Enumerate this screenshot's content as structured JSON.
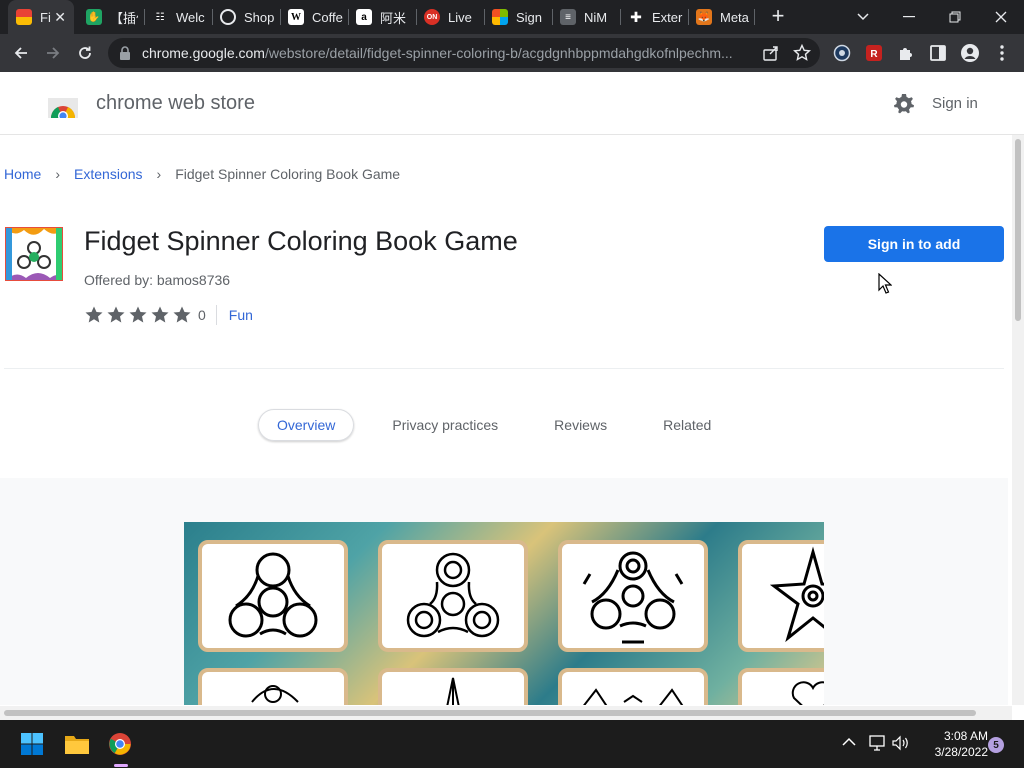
{
  "browser": {
    "tabs": [
      {
        "title": "Fi",
        "favicon": "chrome-store-icon",
        "color": "#e94235",
        "active": true
      },
      {
        "title": "【插件",
        "favicon": "green-hand-icon",
        "color": "#1fa463",
        "active": false
      },
      {
        "title": "Welc",
        "favicon": "list-icon",
        "color": "#ffffff",
        "active": false
      },
      {
        "title": "Shop",
        "favicon": "aperture-icon",
        "color": "#ffffff",
        "active": false
      },
      {
        "title": "Coffe",
        "favicon": "wikipedia-icon",
        "color": "#ffffff",
        "active": false
      },
      {
        "title": "阿米",
        "favicon": "amazon-icon",
        "color": "#ffffff",
        "active": false
      },
      {
        "title": "Live",
        "favicon": "live-icon",
        "color": "#d93025",
        "active": false
      },
      {
        "title": "Sign",
        "favicon": "microsoft-icon",
        "color": "#f25022",
        "active": false
      },
      {
        "title": "NiM",
        "favicon": "nim-icon",
        "color": "#5f6368",
        "active": false
      },
      {
        "title": "Exter",
        "favicon": "puzzle-icon",
        "color": "#ffffff",
        "active": false
      },
      {
        "title": "Meta",
        "favicon": "metamask-icon",
        "color": "#e2761b",
        "active": false
      }
    ],
    "url_host": "chrome.google.com",
    "url_path": "/webstore/detail/fidget-spinner-coloring-b/acgdgnhbppmdahgdkofnlpechm..."
  },
  "header": {
    "store_name": "chrome web store",
    "signin": "Sign in"
  },
  "breadcrumb": {
    "home": "Home",
    "extensions": "Extensions",
    "current": "Fidget Spinner Coloring Book Game"
  },
  "app": {
    "title": "Fidget Spinner Coloring Book Game",
    "offered_by": "Offered by: bamos8736",
    "rating_count": "0",
    "rating_stars": 0,
    "category": "Fun",
    "add_button": "Sign in to add"
  },
  "page_tabs": [
    "Overview",
    "Privacy practices",
    "Reviews",
    "Related"
  ],
  "taskbar": {
    "time": "3:08 AM",
    "date": "3/28/2022",
    "notifications": "5"
  },
  "colors": {
    "accent": "#1a73e8",
    "link": "#3367d6",
    "chrome_dark": "#202124",
    "toolbar": "#35363a"
  }
}
